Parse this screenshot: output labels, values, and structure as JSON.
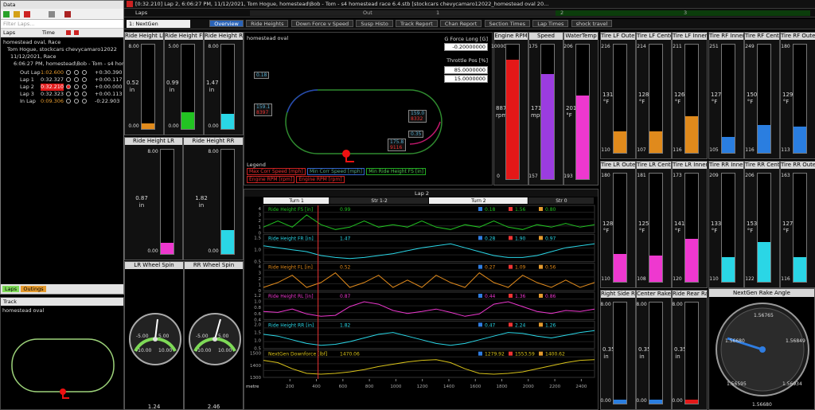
{
  "titlebar": {
    "text": "[0:32.210] Lap 2, 6:06:27 PM, 11/12/2021, Tom Hogue, homestead\\Bob - Tom - s4 homestead race 6.4.stb [stockcars chevycamaro12022_homestead oval 20...",
    "laps_label": "Laps",
    "out_label": "Out",
    "lap_markers": [
      "1",
      "2",
      "3"
    ]
  },
  "data_panel": {
    "title": "Data",
    "filter_placeholder": "Filter Laps...",
    "col_laps": "Laps",
    "col_time": "Time",
    "tree_root": "homestead oval, Race",
    "tree_driver": "Tom Hogue, stockcars chevycamaro12022",
    "tree_session": "11/12/2021, Race",
    "tree_run": "6:06:27 PM, homestead\\Bob - Tom - s4 homestead race 6.4.stb",
    "laps": [
      {
        "name": "Out Lap",
        "time": "1:02.600",
        "delta": "+0:30.390"
      },
      {
        "name": "Lap 1",
        "time": "0:32.327",
        "delta": "+0:00.117"
      },
      {
        "name": "Lap 2",
        "time": "0:32.210",
        "delta": "+0:00.000"
      },
      {
        "name": "Lap 3",
        "time": "0:32.323",
        "delta": "+0:00.113"
      },
      {
        "name": "In Lap",
        "time": "0:09.306",
        "delta": "-0:22.903"
      }
    ],
    "bottom_tabs": [
      "Laps",
      "Outings"
    ]
  },
  "track_panel": {
    "title": "Track",
    "name": "homestead oval"
  },
  "workspace_tabs": {
    "selector": "1: NextGen",
    "tabs": [
      "Overview",
      "Ride Heights",
      "Down Force v Speed",
      "Susp Histo",
      "Track Report",
      "Chan Report",
      "Section Times",
      "Lap Times",
      "shock travel"
    ]
  },
  "ride_heights": [
    {
      "label": "Ride Height LF",
      "max": "8.00",
      "min": "0.00",
      "value": "0.52",
      "unit": "in",
      "color": "#e08a1c",
      "fill": 0.065
    },
    {
      "label": "Ride Height FR",
      "max": "5.00",
      "min": "0.00",
      "value": "0.99",
      "unit": "in",
      "color": "#22c322",
      "fill": 0.2
    },
    {
      "label": "Ride Height RR",
      "max": "8.00",
      "min": "0.00",
      "value": "1.47",
      "unit": "in",
      "color": "#2ad6e6",
      "fill": 0.18
    },
    {
      "label": "Ride Height LR",
      "max": "8.00",
      "min": "0.00",
      "value": "0.87",
      "unit": "in",
      "color": "#ee38cf",
      "fill": 0.11
    },
    {
      "label": "Ride Height RR",
      "max": "8.00",
      "min": "0.00",
      "value": "1.82",
      "unit": "in",
      "color": "#2ad6e6",
      "fill": 0.23
    }
  ],
  "wheel_spin": [
    {
      "label": "LR Wheel Spin",
      "lo": "-10.00",
      "hi": "10.00",
      "a": "-5.00",
      "b": "5.00",
      "reading": "1.24"
    },
    {
      "label": "RR Wheel Spin",
      "lo": "-10.00",
      "hi": "10.00",
      "a": "-5.00",
      "b": "5.00",
      "reading": "2.46"
    }
  ],
  "track_map": {
    "title": "homestead oval",
    "g_force_label": "G Force Long [G]",
    "g_force_value": "-0.20000000",
    "throttle_label": "Throttle Pos [%]",
    "throttle_values": [
      "85.0000000",
      "15.0000000"
    ],
    "markers": [
      {
        "value": "0.18",
        "text2": ""
      },
      {
        "value": "159.1",
        "text2": "8397"
      },
      {
        "value": "159.0",
        "text2": "8332"
      },
      {
        "value": "0.35",
        "text2": ""
      },
      {
        "value": "175.8",
        "text2": "9116"
      }
    ],
    "legend_title": "Legend",
    "legend": [
      "Max Corr Speed [mph]",
      "Min Corr Speed [mph]",
      "Min Ride Height FS [in]",
      "Engine RPM [rpm]",
      "Engine RPM [rpm]"
    ]
  },
  "engine_bars": [
    {
      "label": "Engine RPM",
      "max": "10000",
      "min": "0",
      "value": "8875",
      "unit": "rpm",
      "color": "#e41818",
      "fill": 0.8875
    },
    {
      "label": "Speed",
      "max": "175",
      "min": "157",
      "value": "171",
      "unit": "mph",
      "color": "#9b3ce0",
      "fill": 0.78
    },
    {
      "label": "WaterTemp",
      "max": "206",
      "min": "193",
      "value": "201",
      "unit": "°F",
      "color": "#ee38cf",
      "fill": 0.62
    }
  ],
  "tires_left": [
    {
      "label": "Tire LF Outer",
      "max": "216",
      "min": "110",
      "value": "131",
      "unit": "°F",
      "color": "#e08a1c",
      "fill": 0.2
    },
    {
      "label": "Tire LF Center",
      "max": "214",
      "min": "107",
      "value": "128",
      "unit": "°F",
      "color": "#e08a1c",
      "fill": 0.2
    },
    {
      "label": "Tire LF Inner",
      "max": "211",
      "min": "116",
      "value": "126",
      "unit": "°F",
      "color": "#e08a1c",
      "fill": 0.34
    },
    {
      "label": "Tire LR Outer",
      "max": "180",
      "min": "110",
      "value": "128",
      "unit": "°F",
      "color": "#ee38cf",
      "fill": 0.26
    },
    {
      "label": "Tire LR Center",
      "max": "181",
      "min": "108",
      "value": "125",
      "unit": "°F",
      "color": "#ee38cf",
      "fill": 0.24
    },
    {
      "label": "Tire LR Inner",
      "max": "173",
      "min": "120",
      "value": "141",
      "unit": "°F",
      "color": "#ee38cf",
      "fill": 0.4
    }
  ],
  "tires_right": [
    {
      "label": "Tire RF Inner",
      "max": "251",
      "min": "105",
      "value": "127",
      "unit": "°F",
      "color": "#2a7ee0",
      "fill": 0.15
    },
    {
      "label": "Tire RF Center",
      "max": "249",
      "min": "116",
      "value": "150",
      "unit": "°F",
      "color": "#2a7ee0",
      "fill": 0.26
    },
    {
      "label": "Tire RF Outer",
      "max": "180",
      "min": "113",
      "value": "129",
      "unit": "°F",
      "color": "#2a7ee0",
      "fill": 0.24
    },
    {
      "label": "Tire RR Inner",
      "max": "209",
      "min": "110",
      "value": "133",
      "unit": "°F",
      "color": "#2ad6e6",
      "fill": 0.23
    },
    {
      "label": "Tire RR Center",
      "max": "206",
      "min": "122",
      "value": "153",
      "unit": "°F",
      "color": "#2ad6e6",
      "fill": 0.37
    },
    {
      "label": "Tire RR Outer",
      "max": "163",
      "min": "116",
      "value": "127",
      "unit": "°F",
      "color": "#2ad6e6",
      "fill": 0.23
    }
  ],
  "rake": [
    {
      "label": "Right Side Rake",
      "max": "8.00",
      "min": "0.00",
      "value": "0.35",
      "unit": "in",
      "color": "#2a7ee0",
      "fill": 0.04
    },
    {
      "label": "Center Rake",
      "max": "8.00",
      "min": "0.00",
      "value": "0.35",
      "unit": "in",
      "color": "#2a7ee0",
      "fill": 0.04
    },
    {
      "label": "Ride Rear Rake",
      "max": "8.00",
      "min": "0.00",
      "value": "0.35",
      "unit": "in",
      "color": "#e41818",
      "fill": 0.04
    }
  ],
  "rake_angle": {
    "label": "NextGen Rake Angle",
    "top": "1.56765",
    "left": "1.56680",
    "right": "1.56849",
    "bl": "1.56595",
    "br": "1.56934",
    "bottom": "1.56680"
  },
  "chart_data": {
    "type": "line",
    "header_lap": "Lap 2",
    "sections": [
      "Turn 1",
      "Str 1-2",
      "Turn 2",
      "Str 0"
    ],
    "x_label": "metre",
    "x_ticks": [
      200,
      400,
      600,
      800,
      1000,
      1200,
      1400,
      1600,
      1800,
      2000,
      2200,
      2400
    ],
    "channels": [
      {
        "name": "Ride Height FS [in]",
        "value": "0.99",
        "min": "0.18",
        "max": "1.56",
        "avg": "0.80",
        "color": "#22c322",
        "yticks": [
          "4",
          "3",
          "2",
          "1",
          "0"
        ],
        "y": [
          0.8,
          0.85,
          0.8,
          0.9,
          0.82,
          0.78,
          0.8,
          0.85,
          0.8,
          0.82,
          0.8,
          0.85,
          0.8,
          0.78,
          0.82,
          0.8,
          0.85,
          0.8,
          0.78,
          0.82,
          0.8,
          0.83,
          0.8,
          0.82
        ]
      },
      {
        "name": "Ride Height FR [in]",
        "value": "1.47",
        "min": "0.28",
        "max": "1.90",
        "avg": "0.97",
        "color": "#2ad6e6",
        "yticks": [
          "1.5",
          "1.0",
          "0.5"
        ],
        "y": [
          1.2,
          1.1,
          1.0,
          0.9,
          0.7,
          0.6,
          0.55,
          0.6,
          0.7,
          0.8,
          0.95,
          1.1,
          1.2,
          1.3,
          1.1,
          0.9,
          0.7,
          0.6,
          0.6,
          0.7,
          0.9,
          1.1,
          1.2,
          1.3
        ]
      },
      {
        "name": "Ride Height FL [in]",
        "value": "0.52",
        "min": "0.27",
        "max": "1.09",
        "avg": "0.56",
        "color": "#e08a1c",
        "yticks": [
          "4",
          "3",
          "2",
          "1",
          "0"
        ],
        "y": [
          0.5,
          0.52,
          0.55,
          0.5,
          0.52,
          0.56,
          0.5,
          0.52,
          0.55,
          0.5,
          0.53,
          0.5,
          0.55,
          0.52,
          0.5,
          0.56,
          0.52,
          0.5,
          0.55,
          0.52,
          0.5,
          0.53,
          0.5,
          0.52
        ]
      },
      {
        "name": "Ride Height RL [in]",
        "value": "0.87",
        "min": "0.44",
        "max": "1.36",
        "avg": "0.86",
        "color": "#ee38cf",
        "yticks": [
          "1.2",
          "1.0",
          "0.8",
          "0.6",
          "0.4"
        ],
        "y": [
          0.8,
          0.78,
          0.85,
          0.75,
          0.7,
          0.72,
          0.9,
          1.0,
          0.95,
          0.82,
          0.76,
          0.8,
          0.85,
          0.78,
          0.7,
          0.75,
          0.95,
          1.0,
          0.9,
          0.8,
          0.76,
          0.82,
          0.8,
          0.85
        ]
      },
      {
        "name": "Ride Height RR [in]",
        "value": "1.82",
        "min": "0.47",
        "max": "2.24",
        "avg": "1.26",
        "color": "#2ad6e6",
        "yticks": [
          "2.0",
          "1.5",
          "1.0",
          "0.5"
        ],
        "y": [
          1.4,
          1.3,
          1.1,
          0.9,
          0.8,
          0.85,
          1.0,
          1.2,
          1.4,
          1.5,
          1.3,
          1.1,
          0.9,
          0.8,
          0.9,
          1.1,
          1.3,
          1.5,
          1.45,
          1.3,
          1.2,
          1.35,
          1.5,
          1.6
        ]
      },
      {
        "name": "NextGen Downforce [lbf]",
        "value": "1470.06",
        "min": "1279.92",
        "max": "1553.59",
        "avg": "1400.62",
        "color": "#d8c21a",
        "yticks": [
          "1500",
          "1400",
          "1300"
        ],
        "y": [
          1470,
          1440,
          1360,
          1300,
          1290,
          1300,
          1320,
          1350,
          1390,
          1420,
          1450,
          1470,
          1480,
          1440,
          1360,
          1300,
          1290,
          1300,
          1320,
          1360,
          1400,
          1440,
          1470,
          1480
        ]
      }
    ]
  }
}
